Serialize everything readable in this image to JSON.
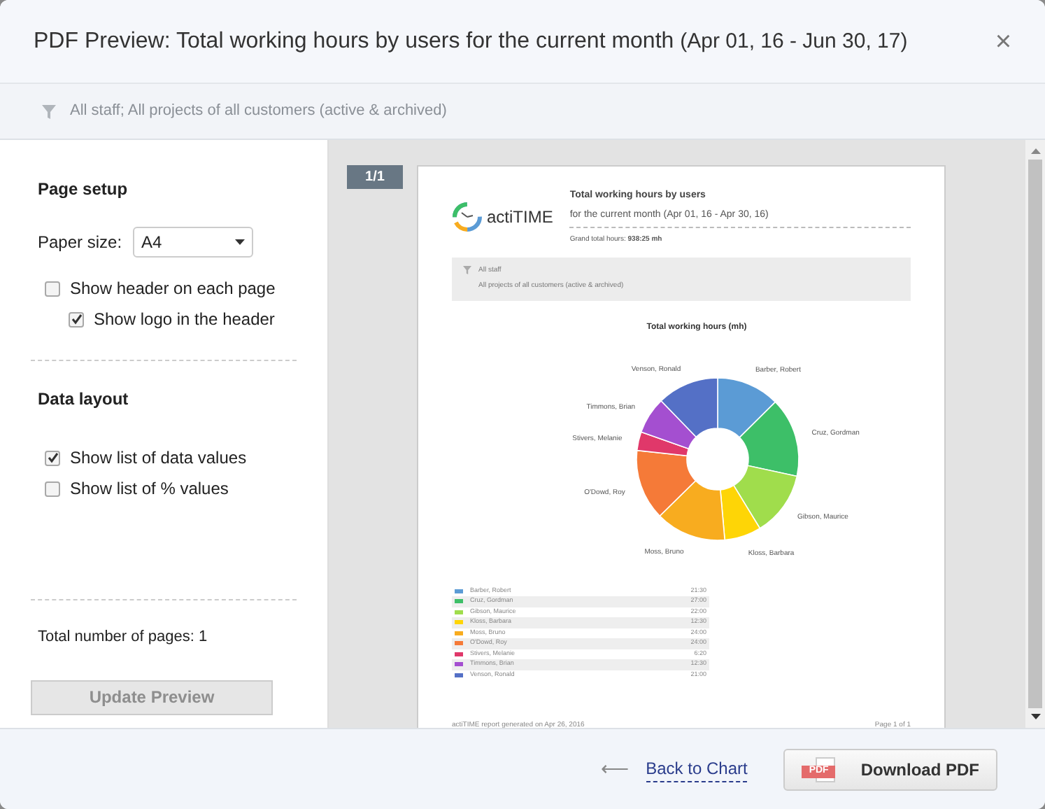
{
  "dialog": {
    "title": "PDF Preview: Total working hours by users for the current month",
    "title_period": "(Apr 01, 16 - Jun 30, 17)",
    "close": "×"
  },
  "filter": "All staff; All projects of all customers (active & archived)",
  "settings": {
    "page_setup": {
      "heading": "Page setup",
      "paper_label": "Paper size:",
      "paper_value": "A4",
      "options": [
        {
          "label": "Show header on each page",
          "checked": false,
          "nested": false
        },
        {
          "label": "Show logo in the header",
          "checked": true,
          "nested": true
        }
      ]
    },
    "data_layout": {
      "heading": "Data layout",
      "options": [
        {
          "label": "Show list of data values",
          "checked": true
        },
        {
          "label": "Show list of % values",
          "checked": false
        }
      ]
    },
    "total_pages": "Total number of pages: 1",
    "update_button": {
      "label": "Update Preview",
      "disabled": true
    }
  },
  "preview": {
    "page_badge": "1/1",
    "logo_text": "actiTIME",
    "report_title": "Total working hours by users",
    "report_subtitle": "for the current month  (Apr 01, 16 - Apr 30, 16)",
    "grand_total_label": "Grand total hours:",
    "grand_total_value": "938:25 mh",
    "filter_lines": [
      "All staff",
      "All projects of all customers (active & archived)"
    ],
    "chart_data": {
      "type": "donut",
      "title": "Total working hours (mh)",
      "categories": [
        "Barber, Robert",
        "Cruz, Gordman",
        "Gibson, Maurice",
        "Kloss, Barbara",
        "Moss, Bruno",
        "O'Dowd, Roy",
        "Stivers, Melanie",
        "Timmons, Brian",
        "Venson, Ronald"
      ],
      "values": [
        12.59,
        15.81,
        12.88,
        7.32,
        14.05,
        14.05,
        3.71,
        7.32,
        12.27
      ]
    },
    "rows": [
      {
        "name": "Barber, Robert",
        "hours": "21:30",
        "color": "#5b9bd5"
      },
      {
        "name": "Cruz, Gordman",
        "hours": "27:00",
        "color": "#3dbf68"
      },
      {
        "name": "Gibson, Maurice",
        "hours": "22:00",
        "color": "#a0dd4c"
      },
      {
        "name": "Kloss, Barbara",
        "hours": "12:30",
        "color": "#fed506"
      },
      {
        "name": "Moss, Bruno",
        "hours": "24:00",
        "color": "#f8ac1f"
      },
      {
        "name": "O'Dowd, Roy",
        "hours": "24:00",
        "color": "#f57a38"
      },
      {
        "name": "Stivers, Melanie",
        "hours": "6:20",
        "color": "#e0386a"
      },
      {
        "name": "Timmons, Brian",
        "hours": "12:30",
        "color": "#a44fd0"
      },
      {
        "name": "Venson, Ronald",
        "hours": "21:00",
        "color": "#5470c6"
      }
    ],
    "footer_left": "actiTIME report generated on Apr 26, 2016",
    "footer_right": "Page 1 of 1"
  },
  "footer": {
    "back_link": "Back to Chart",
    "back_arrow": "⟵",
    "download_button": "Download PDF",
    "pdf_icon_text": "PDF"
  }
}
